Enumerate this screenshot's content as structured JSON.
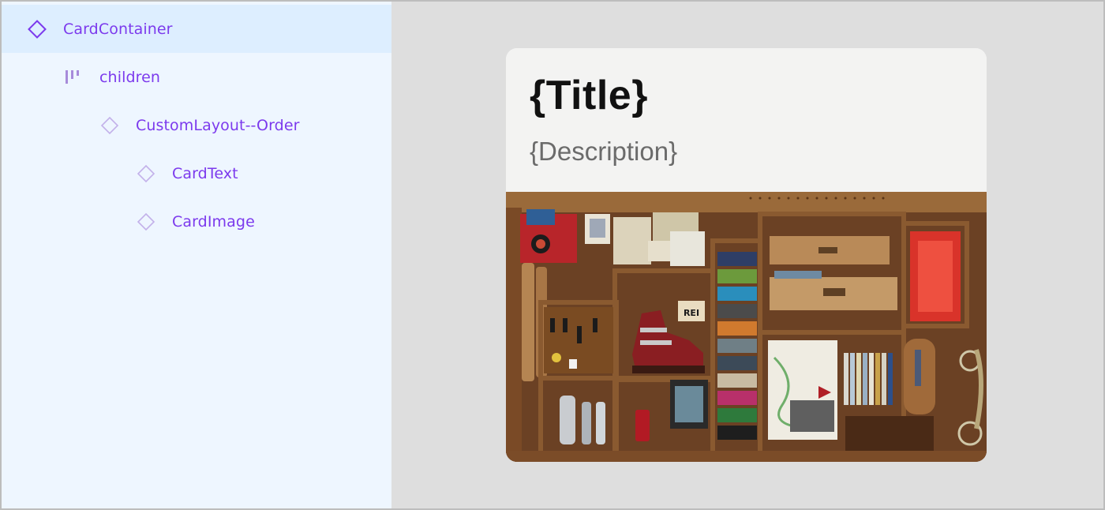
{
  "layers": {
    "items": [
      {
        "label": "CardContainer",
        "icon": "component-icon",
        "selected": true
      },
      {
        "label": "children",
        "icon": "slot-icon",
        "selected": false
      },
      {
        "label": "CustomLayout--Order",
        "icon": "instance-icon",
        "selected": false
      },
      {
        "label": "CardText",
        "icon": "instance-icon",
        "selected": false
      },
      {
        "label": "CardImage",
        "icon": "instance-icon",
        "selected": false
      }
    ]
  },
  "card": {
    "title": "{Title}",
    "description": "{Description}",
    "image_label": "REI"
  },
  "colors": {
    "accent": "#7c3aed",
    "panel_bg": "#eef6ff",
    "selected_row": "#ddeeff",
    "canvas_bg": "#dedede"
  }
}
